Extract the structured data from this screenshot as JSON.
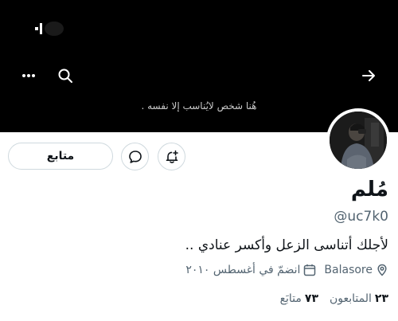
{
  "banner": {
    "caption": "هُنا شخص لايُناسب إلا نفسه ."
  },
  "header": {
    "back_icon": "arrow-right-icon",
    "search_icon": "search-icon",
    "more_icon": "more-horizontal-icon"
  },
  "actions": {
    "follow_label": "متابع",
    "message_icon": "message-bubble-icon",
    "notify_icon": "bell-plus-icon"
  },
  "profile": {
    "name": "مُلم",
    "handle": "@uc7k0",
    "bio": "لأجلك أتناسى الزعل وأكسر عنادي ..",
    "location": "Balasore",
    "joined": "انضمّ في أغسطس ٢٠١٠"
  },
  "stats": {
    "following_count": "٧٣",
    "following_label": "متابَع",
    "followers_count": "٢٣",
    "followers_label": "المتابعون"
  },
  "colors": {
    "banner": "#000000",
    "text_primary": "#0f1419",
    "text_secondary": "#536471",
    "border": "#cfd9de"
  }
}
